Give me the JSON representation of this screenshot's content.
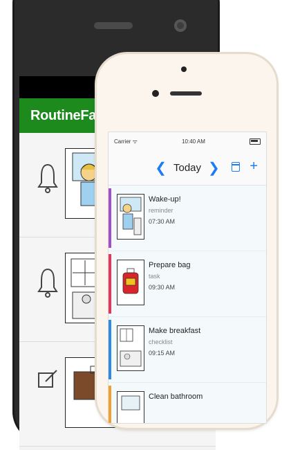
{
  "android": {
    "app_title": "RoutineFactory",
    "rows": [
      {
        "icon": "bell-icon"
      },
      {
        "icon": "bell-icon"
      },
      {
        "icon": "edit-icon"
      }
    ]
  },
  "ios": {
    "status": {
      "carrier": "Carrier ᯤ",
      "time": "10:40 AM"
    },
    "nav": {
      "prev": "❮",
      "title": "Today",
      "next": "❯",
      "add": "+"
    },
    "tasks": [
      {
        "name": "Wake-up!",
        "type": "reminder",
        "time": "07:30 AM",
        "color": "#a24fc8"
      },
      {
        "name": "Prepare bag",
        "type": "task",
        "time": "09:30 AM",
        "color": "#e8345a"
      },
      {
        "name": "Make breakfast",
        "type": "checklist",
        "time": "09:15 AM",
        "color": "#2f8be0"
      },
      {
        "name": "Clean bathroom",
        "type": "",
        "time": "",
        "color": "#f0a030"
      }
    ]
  }
}
